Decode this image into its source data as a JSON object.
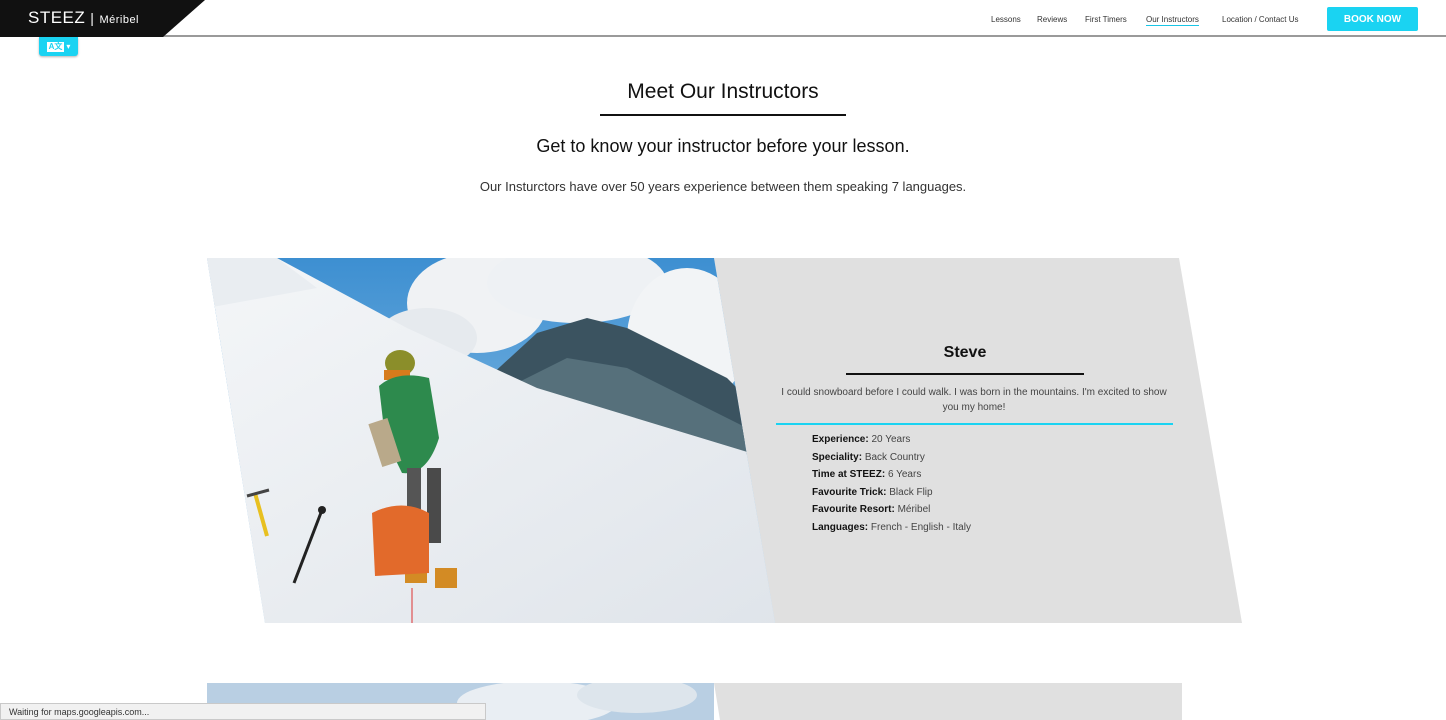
{
  "header": {
    "brand": "STEEZ",
    "separator": "|",
    "location": "Méribel",
    "nav": [
      {
        "label": "Lessons",
        "active": false
      },
      {
        "label": "Reviews",
        "active": false
      },
      {
        "label": "First Timers",
        "active": false
      },
      {
        "label": "Our Instructors",
        "active": true
      },
      {
        "label": "Location / Contact Us",
        "active": false
      }
    ],
    "book_now": "BOOK NOW"
  },
  "translate_widget": {
    "icon": "translate-icon"
  },
  "intro": {
    "title": "Meet Our Instructors",
    "subtitle": "Get to know your instructor before your lesson.",
    "description": "Our Insturctors have over 50 years experience between them speaking 7 languages."
  },
  "instructor": {
    "name": "Steve",
    "bio": "I could snowboard before I could walk. I was born in the mountains. I'm excited to show you my home!",
    "facts": [
      {
        "label": "Experience:",
        "value": "20 Years"
      },
      {
        "label": "Speciality:",
        "value": "Back Country"
      },
      {
        "label": "Time at STEEZ:",
        "value": "6 Years"
      },
      {
        "label": "Favourite Trick:",
        "value": "Black Flip"
      },
      {
        "label": "Favourite Resort:",
        "value": "Méribel"
      },
      {
        "label": "Languages:",
        "value": "French - English - Italy"
      }
    ]
  },
  "status_bar": "Waiting for maps.googleapis.com...",
  "colors": {
    "accent": "#1ad3f2",
    "panel": "#e0e0e0",
    "logo_bg": "#111111"
  }
}
